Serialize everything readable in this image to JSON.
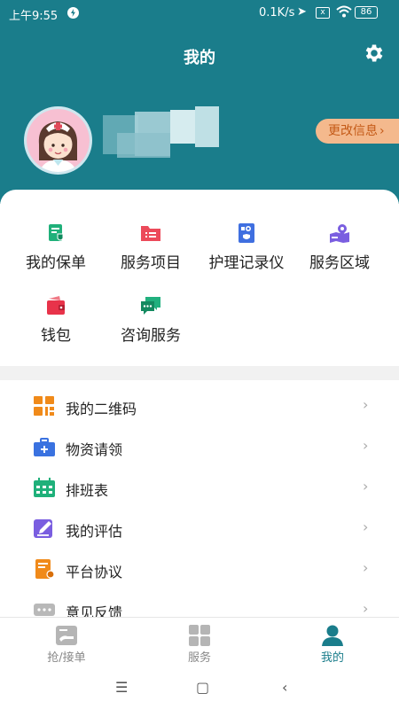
{
  "status_bar": {
    "time": "上午9:55",
    "network_speed": "0.1K/s",
    "sim_label": "x",
    "battery": "86",
    "icons": [
      "bolt-icon",
      "location-arrow-icon",
      "sim-icon",
      "wifi-icon",
      "battery-icon"
    ]
  },
  "header": {
    "title": "我的",
    "settings_icon": "gear-icon",
    "edit_label": "更改信息",
    "edit_chevron": "›"
  },
  "colors": {
    "header_bg": "#1a7d8b",
    "edit_button_bg": "#f4b98d",
    "edit_button_text": "#c45a17",
    "active_tab": "#1a7d8b"
  },
  "grid": [
    {
      "label": "我的保单",
      "icon": "policy-icon"
    },
    {
      "label": "服务项目",
      "icon": "service-items-icon"
    },
    {
      "label": "护理记录仪",
      "icon": "nursing-recorder-icon"
    },
    {
      "label": "服务区域",
      "icon": "service-area-icon"
    },
    {
      "label": "钱包",
      "icon": "wallet-icon"
    },
    {
      "label": "咨询服务",
      "icon": "consult-icon"
    }
  ],
  "list": [
    {
      "label": "我的二维码",
      "icon": "qr-code-icon"
    },
    {
      "label": "物资请领",
      "icon": "supplies-icon"
    },
    {
      "label": "排班表",
      "icon": "schedule-icon"
    },
    {
      "label": "我的评估",
      "icon": "evaluation-icon"
    },
    {
      "label": "平台协议",
      "icon": "agreement-icon"
    },
    {
      "label": "意见反馈",
      "icon": "feedback-icon"
    }
  ],
  "list_chevron": "›",
  "bottom_nav": [
    {
      "label": "抢/接单",
      "icon": "grab-order-icon",
      "active": false
    },
    {
      "label": "服务",
      "icon": "services-grid-icon",
      "active": false
    },
    {
      "label": "我的",
      "icon": "profile-icon",
      "active": true
    }
  ],
  "system_nav": {
    "menu": "☰",
    "home": "▢",
    "back": "‹"
  }
}
